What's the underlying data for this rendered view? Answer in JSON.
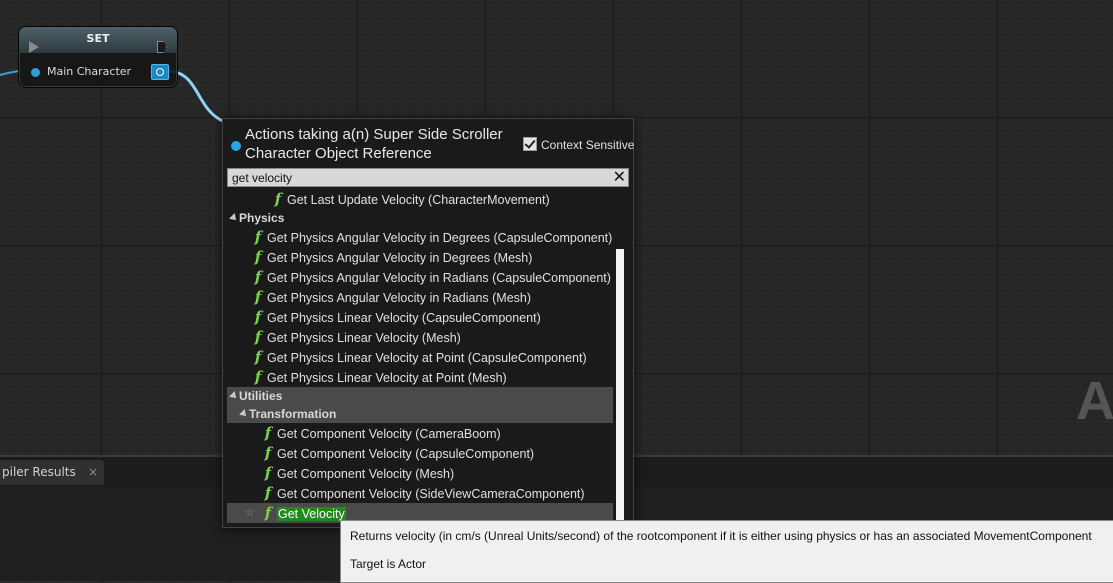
{
  "node": {
    "title": "SET",
    "pin_label": "Main Character"
  },
  "bottom": {
    "tab_label": "piler Results",
    "tab_close": "×"
  },
  "background_letter": "A",
  "menu": {
    "title": "Actions taking a(n) Super Side Scroller Character Object Reference",
    "context_label": "Context Sensitive",
    "context_checked": true,
    "search_value": "get velocity",
    "clear_symbol": "✕",
    "function_glyph": "f",
    "items": {
      "top_item": "Get Last Update Velocity (CharacterMovement)",
      "physics_category": "Physics",
      "physics": [
        "Get Physics Angular Velocity in Degrees (CapsuleComponent)",
        "Get Physics Angular Velocity in Degrees (Mesh)",
        "Get Physics Angular Velocity in Radians (CapsuleComponent)",
        "Get Physics Angular Velocity in Radians (Mesh)",
        "Get Physics Linear Velocity (CapsuleComponent)",
        "Get Physics Linear Velocity (Mesh)",
        "Get Physics Linear Velocity at Point (CapsuleComponent)",
        "Get Physics Linear Velocity at Point (Mesh)"
      ],
      "utilities_category": "Utilities",
      "transformation_category": "Transformation",
      "transformation": [
        "Get Component Velocity (CameraBoom)",
        "Get Component Velocity (CapsuleComponent)",
        "Get Component Velocity (Mesh)",
        "Get Component Velocity (SideViewCameraComponent)"
      ],
      "selected": "Get Velocity",
      "star": "☆"
    }
  },
  "tooltip": {
    "line1": "Returns velocity (in cm/s (Unreal Units/second) of the rootcomponent if it is either using physics or has an associated MovementComponent",
    "line2": "Target is Actor"
  },
  "colors": {
    "accent_blue": "#24a5e6",
    "function_green": "#7ad14a",
    "highlight_green": "#1f8a1f"
  }
}
